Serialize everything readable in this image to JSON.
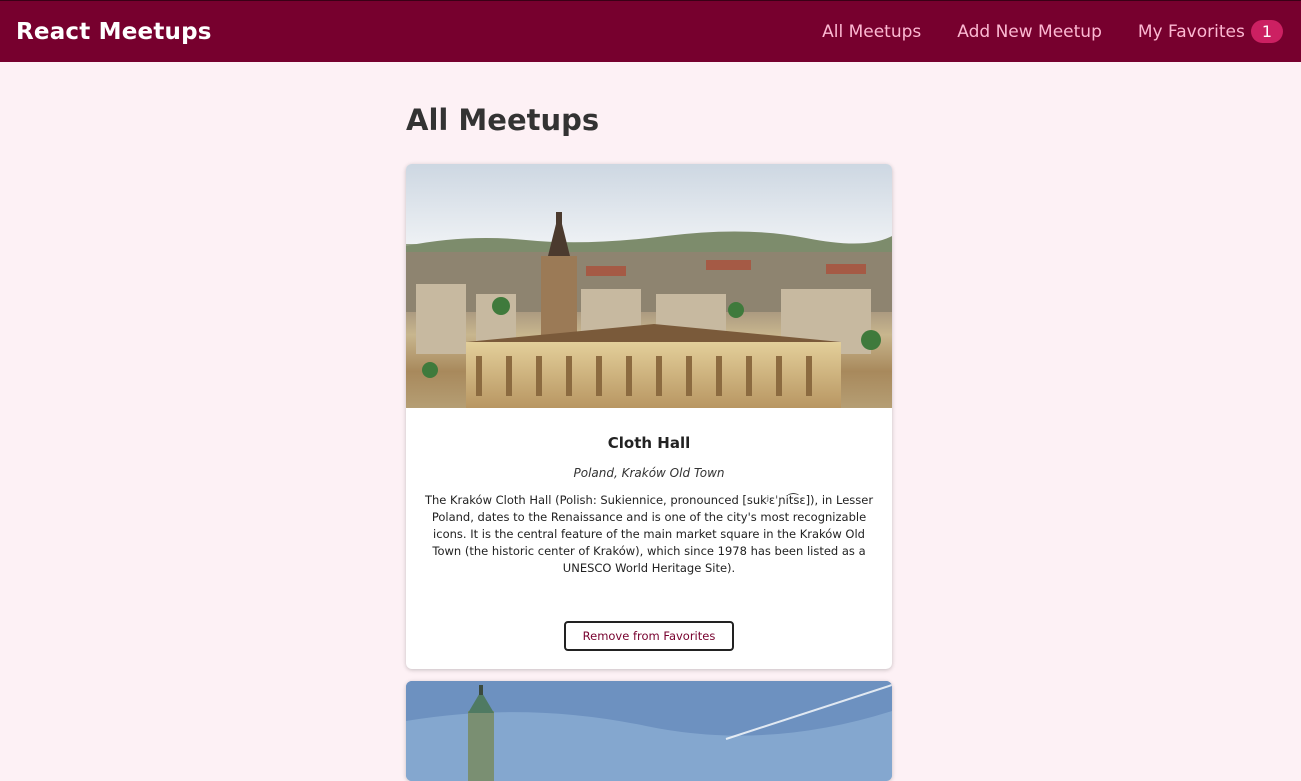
{
  "header": {
    "logo": "React Meetups",
    "nav": {
      "all_meetups": "All Meetups",
      "add_new_meetup": "Add New Meetup",
      "my_favorites": "My Favorites",
      "favorites_count": "1"
    }
  },
  "main": {
    "title": "All Meetups",
    "meetups": [
      {
        "title": "Cloth Hall",
        "address": "Poland, Kraków Old Town",
        "description": "The Kraków Cloth Hall (Polish: Sukiennice, pronounced [sukʲɛˈɲit͡sɛ]), in Lesser Poland, dates to the Renaissance and is one of the city's most recognizable icons. It is the central feature of the main market square in the Kraków Old Town (the historic center of Kraków), which since 1978 has been listed as a UNESCO World Heritage Site).",
        "button_label": "Remove from Favorites"
      }
    ]
  },
  "colors": {
    "header_bg": "#77002e",
    "nav_link": "#fcb8d2",
    "badge_bg": "#cc2062",
    "page_bg": "#fdf1f5"
  }
}
